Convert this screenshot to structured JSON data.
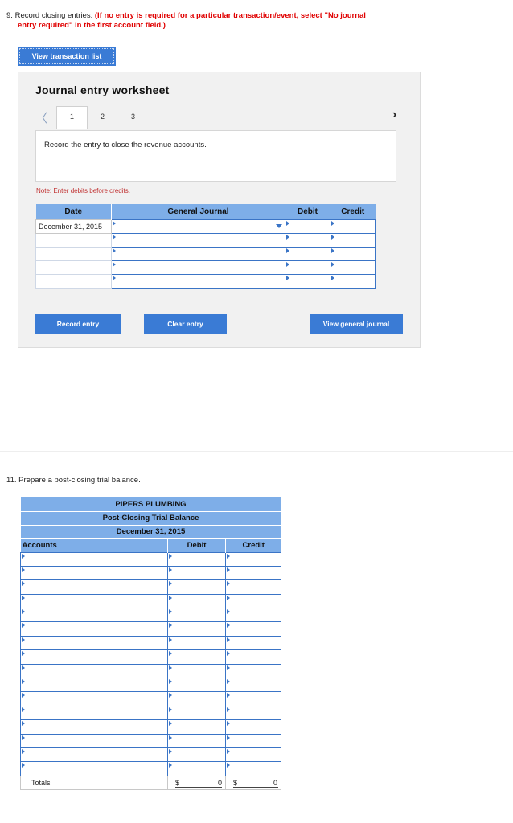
{
  "question9": {
    "number": "9.",
    "text": "Record closing entries.",
    "instruction": "(If no entry is required for a particular transaction/event, select \"No journal entry required\" in the first account field.)",
    "instruction_line1": "(If no entry is required for a particular transaction/event, select \"No journal",
    "instruction_line2": "entry required\" in the first account field.)"
  },
  "view_transaction_button": "View transaction list",
  "worksheet": {
    "title": "Journal entry worksheet",
    "tabs": [
      "1",
      "2",
      "3"
    ],
    "active_tab": "1",
    "instruction": "Record the entry to close the revenue accounts.",
    "note": "Note: Enter debits before credits.",
    "columns": [
      "Date",
      "General Journal",
      "Debit",
      "Credit"
    ],
    "first_row_date": "December 31, 2015",
    "rows_count_label": ""
  },
  "buttons": {
    "record_entry": "Record entry",
    "clear_entry": "Clear entry",
    "view_general_journal": "View general journal"
  },
  "question11": {
    "number": "11.",
    "text": "Prepare a post-closing trial balance."
  },
  "trial_balance": {
    "company": "PIPERS PLUMBING",
    "title": "Post-Closing Trial Balance",
    "date": "December 31, 2015",
    "columns": [
      "Accounts",
      "Debit",
      "Credit"
    ],
    "totals_label": "Totals",
    "currency": "$",
    "debit_total": "0",
    "credit_total": "0"
  },
  "colors": {
    "accent_blue": "#3a7bd5",
    "header_blue": "#7eaee8",
    "instruction_red": "#e00000"
  }
}
